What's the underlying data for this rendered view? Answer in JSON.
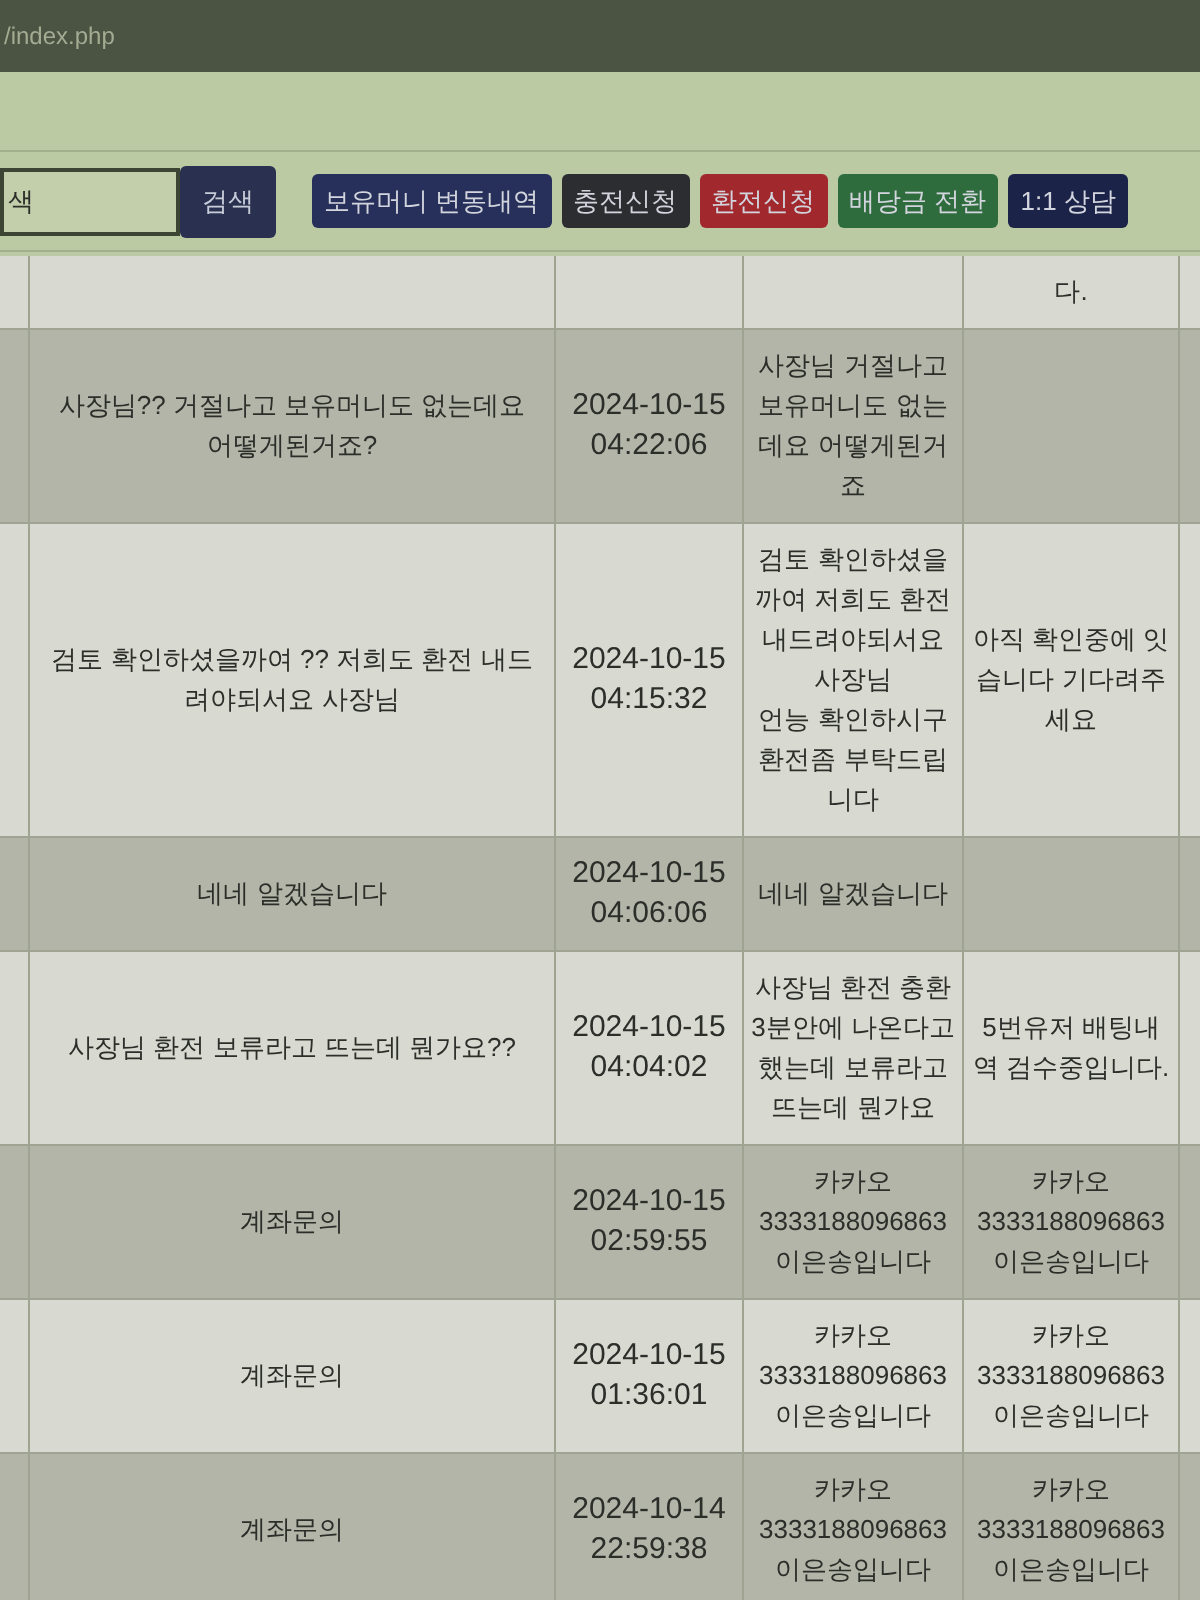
{
  "browser": {
    "url": "/index.php"
  },
  "search": {
    "placeholder": "색",
    "button": "검색"
  },
  "buttons": [
    {
      "label": "보유머니 변동내역",
      "color": "#27305a"
    },
    {
      "label": "충전신청",
      "color": "#2b2d31"
    },
    {
      "label": "환전신청",
      "color": "#a1282d"
    },
    {
      "label": "배당금 전환",
      "color": "#2e6b3d"
    },
    {
      "label": "1:1 상담",
      "color": "#1c2348"
    }
  ],
  "table": {
    "rows": [
      {
        "answer": "다."
      },
      {
        "title": "사장님?? 거절나고 보유머니도 없는데요 어떻게된거죠?",
        "date": "2024-10-15 04:22:06",
        "content": "사장님 거절나고 보유머니도 없는데요 어떻게된거죠"
      },
      {
        "title": "검토 확인하셨을까여 ?? 저희도 환전 내드려야되서요 사장님",
        "date": "2024-10-15 04:15:32",
        "content": "검토 확인하셨을까여 저희도 환전 내드려야되서요 사장님\n언능 확인하시구 환전좀 부탁드립니다",
        "answer": "아직 확인중에 잇습니다 기다려주세요"
      },
      {
        "title": "네네 알겠습니다",
        "date": "2024-10-15 04:06:06",
        "content": "네네 알겠습니다"
      },
      {
        "title": "사장님 환전 보류라고 뜨는데 뭔가요??",
        "date": "2024-10-15 04:04:02",
        "content": "사장님 환전 충환3분안에 나온다고했는데 보류라고 뜨는데 뭔가요",
        "answer": "5번유저 배팅내역 검수중입니다."
      },
      {
        "title": "계좌문의",
        "date": "2024-10-15 02:59:55",
        "content": "카카오\n3333188096863\n이은송입니다",
        "answer": "카카오\n3333188096863\n이은송입니다"
      },
      {
        "title": "계좌문의",
        "date": "2024-10-15 01:36:01",
        "content": "카카오\n3333188096863\n이은송입니다",
        "answer": "카카오\n3333188096863\n이은송입니다"
      },
      {
        "title": "계좌문의",
        "date": "2024-10-14 22:59:38",
        "content": "카카오\n3333188096863\n이은송입니다",
        "answer": "카카오\n3333188096863\n이은송입니다"
      }
    ]
  }
}
